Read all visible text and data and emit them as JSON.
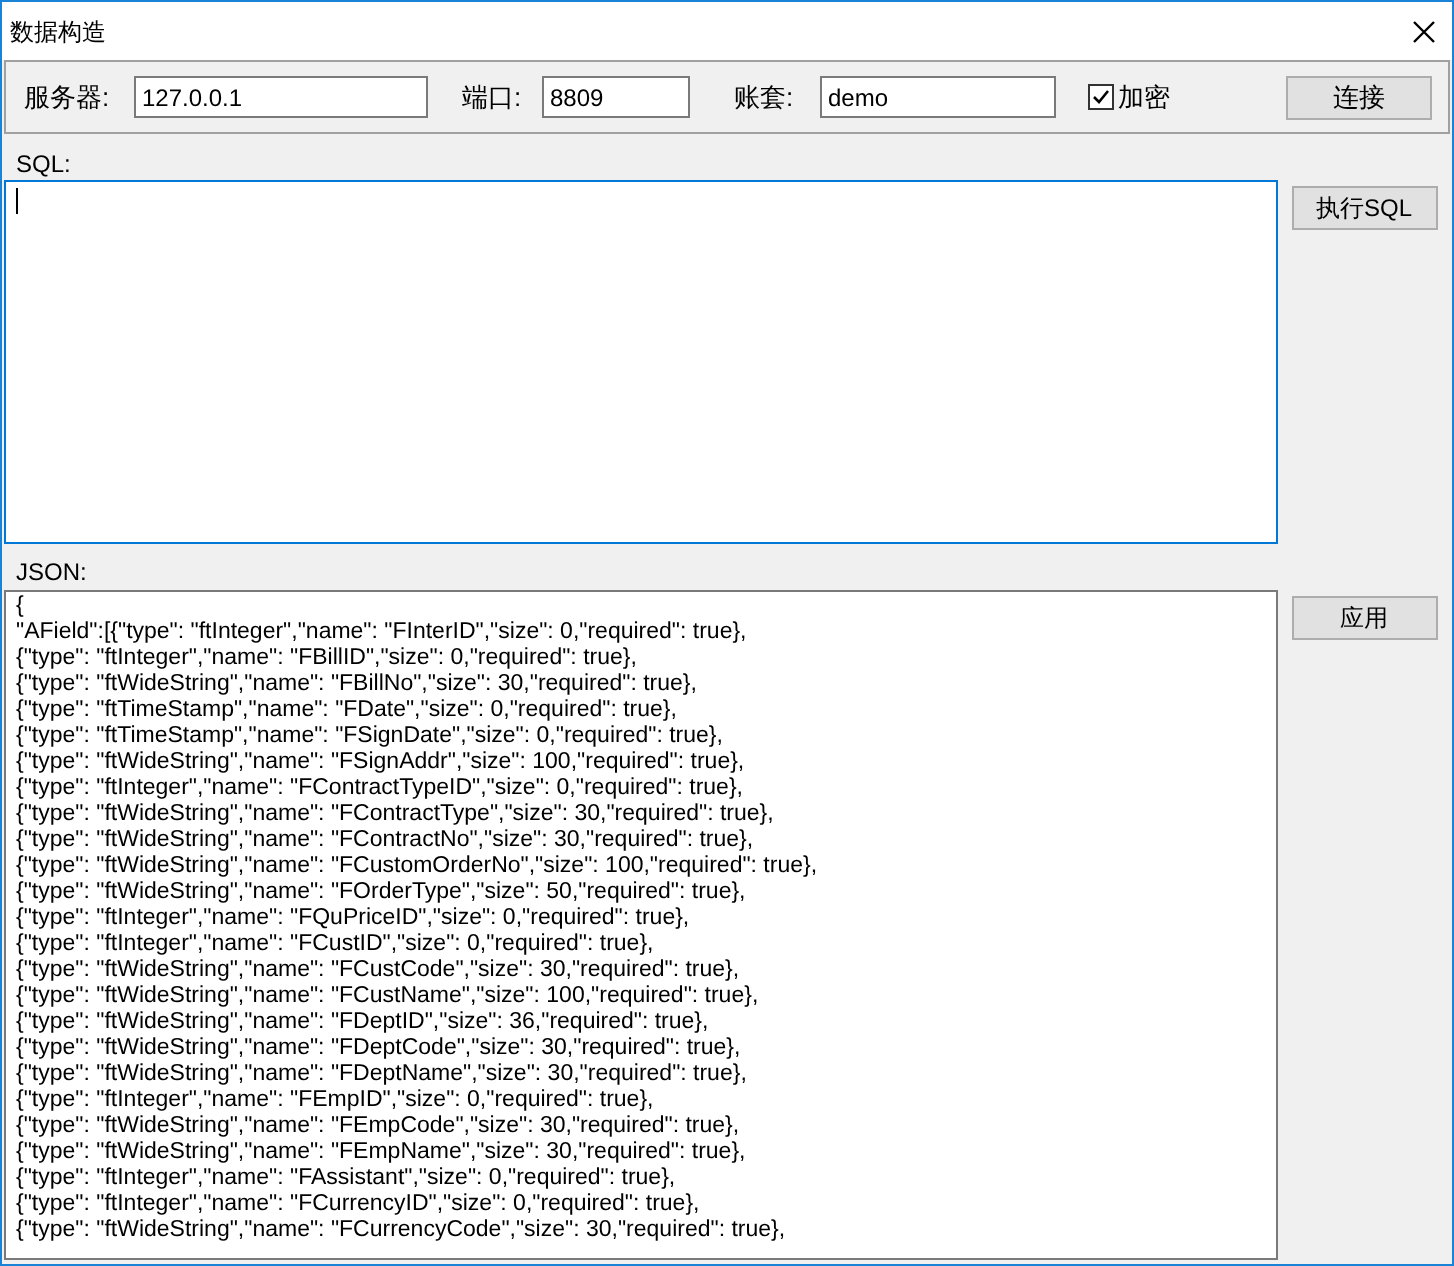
{
  "window": {
    "title": "数据构造"
  },
  "connection": {
    "server": {
      "label": "服务器:",
      "value": "127.0.0.1"
    },
    "port": {
      "label": "端口:",
      "value": "8809"
    },
    "account": {
      "label": "账套:",
      "value": "demo"
    },
    "encrypt": {
      "label": "加密",
      "checked": true
    },
    "connect_button": "连接"
  },
  "sql": {
    "label": "SQL:",
    "focused": true,
    "button": "执行SQL"
  },
  "json": {
    "label": "JSON:",
    "button": "应用",
    "lines": [
      "{",
      "\"AField\":[{\"type\": \"ftInteger\",\"name\": \"FInterID\",\"size\": 0,\"required\": true},",
      "{\"type\": \"ftInteger\",\"name\": \"FBillID\",\"size\": 0,\"required\": true},",
      "{\"type\": \"ftWideString\",\"name\": \"FBillNo\",\"size\": 30,\"required\": true},",
      "{\"type\": \"ftTimeStamp\",\"name\": \"FDate\",\"size\": 0,\"required\": true},",
      "{\"type\": \"ftTimeStamp\",\"name\": \"FSignDate\",\"size\": 0,\"required\": true},",
      "{\"type\": \"ftWideString\",\"name\": \"FSignAddr\",\"size\": 100,\"required\": true},",
      "{\"type\": \"ftInteger\",\"name\": \"FContractTypeID\",\"size\": 0,\"required\": true},",
      "{\"type\": \"ftWideString\",\"name\": \"FContractType\",\"size\": 30,\"required\": true},",
      "{\"type\": \"ftWideString\",\"name\": \"FContractNo\",\"size\": 30,\"required\": true},",
      "{\"type\": \"ftWideString\",\"name\": \"FCustomOrderNo\",\"size\": 100,\"required\": true},",
      "{\"type\": \"ftWideString\",\"name\": \"FOrderType\",\"size\": 50,\"required\": true},",
      "{\"type\": \"ftInteger\",\"name\": \"FQuPriceID\",\"size\": 0,\"required\": true},",
      "{\"type\": \"ftInteger\",\"name\": \"FCustID\",\"size\": 0,\"required\": true},",
      "{\"type\": \"ftWideString\",\"name\": \"FCustCode\",\"size\": 30,\"required\": true},",
      "{\"type\": \"ftWideString\",\"name\": \"FCustName\",\"size\": 100,\"required\": true},",
      "{\"type\": \"ftWideString\",\"name\": \"FDeptID\",\"size\": 36,\"required\": true},",
      "{\"type\": \"ftWideString\",\"name\": \"FDeptCode\",\"size\": 30,\"required\": true},",
      "{\"type\": \"ftWideString\",\"name\": \"FDeptName\",\"size\": 30,\"required\": true},",
      "{\"type\": \"ftInteger\",\"name\": \"FEmpID\",\"size\": 0,\"required\": true},",
      "{\"type\": \"ftWideString\",\"name\": \"FEmpCode\",\"size\": 30,\"required\": true},",
      "{\"type\": \"ftWideString\",\"name\": \"FEmpName\",\"size\": 30,\"required\": true},",
      "{\"type\": \"ftInteger\",\"name\": \"FAssistant\",\"size\": 0,\"required\": true},",
      "{\"type\": \"ftInteger\",\"name\": \"FCurrencyID\",\"size\": 0,\"required\": true},",
      "{\"type\": \"ftWideString\",\"name\": \"FCurrencyCode\",\"size\": 30,\"required\": true},"
    ]
  }
}
